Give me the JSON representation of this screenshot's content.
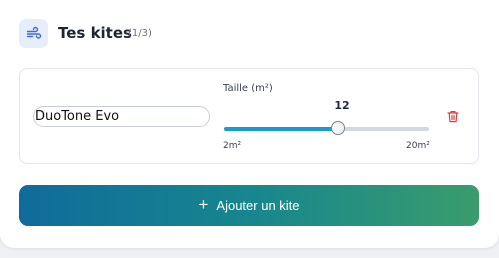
{
  "header": {
    "icon": "wind-icon",
    "title": "Tes kites",
    "count": "(1/3)"
  },
  "kites": [
    {
      "name": "DuoTone Evo",
      "size_label": "Taille (m²)",
      "size_value": "12",
      "size": 12,
      "min": 2,
      "max": 20,
      "min_label": "2m²",
      "max_label": "20m²",
      "delete_icon": "trash-icon"
    }
  ],
  "add_button": {
    "icon": "plus-icon",
    "label": "Ajouter un kite"
  },
  "colors": {
    "accent": "#1a9bd0",
    "danger": "#e23d3d",
    "gradient_start": "#106b9b",
    "gradient_end": "#3a9c6c"
  }
}
